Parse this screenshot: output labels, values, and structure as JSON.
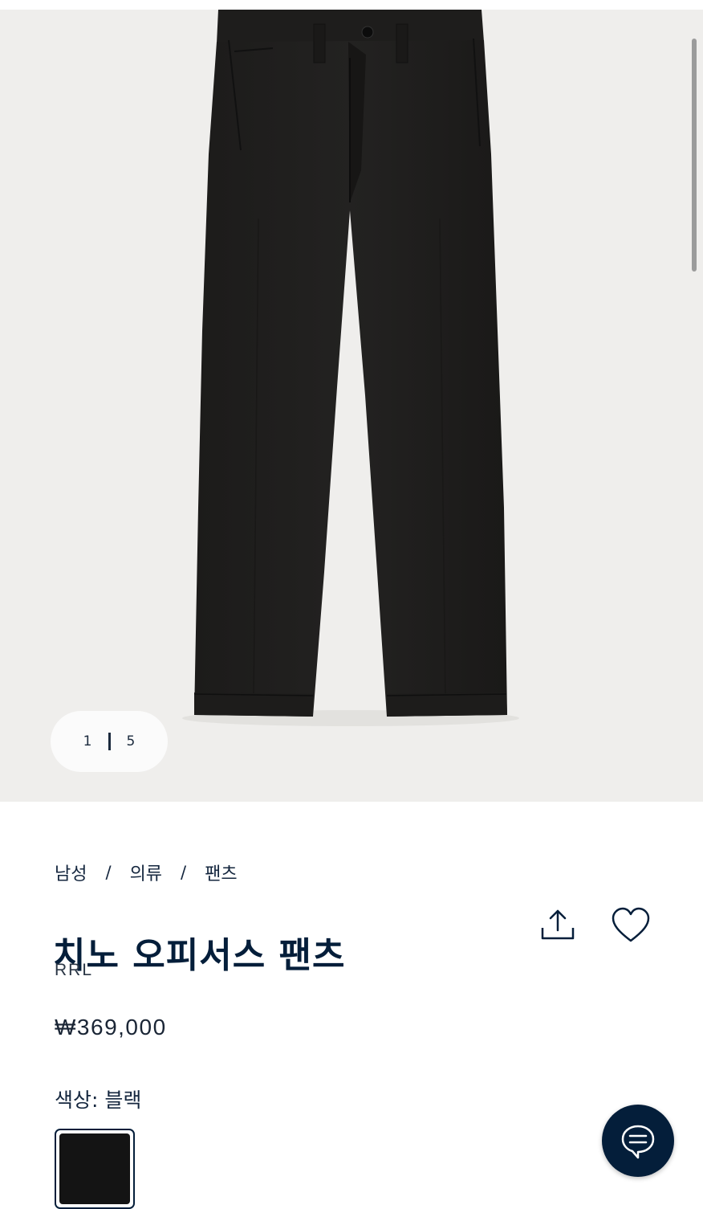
{
  "gallery": {
    "image_alt": "chino-pants",
    "counter": {
      "current": "1",
      "total": "5"
    }
  },
  "breadcrumb": {
    "items": [
      "남성",
      "의류",
      "팬츠"
    ],
    "separator": "/"
  },
  "product": {
    "title": "치노 오피서스 팬츠",
    "brand": "RRL",
    "price": "₩369,000",
    "color_label": "색상: 블랙"
  },
  "swatch": {
    "name": "블랙",
    "color": "#141414"
  },
  "icons": {
    "share": "share-icon",
    "wishlist": "heart-icon",
    "chat": "chat-icon"
  },
  "colors": {
    "navy": "#041e3a",
    "gallery_bg": "#efeeec"
  }
}
